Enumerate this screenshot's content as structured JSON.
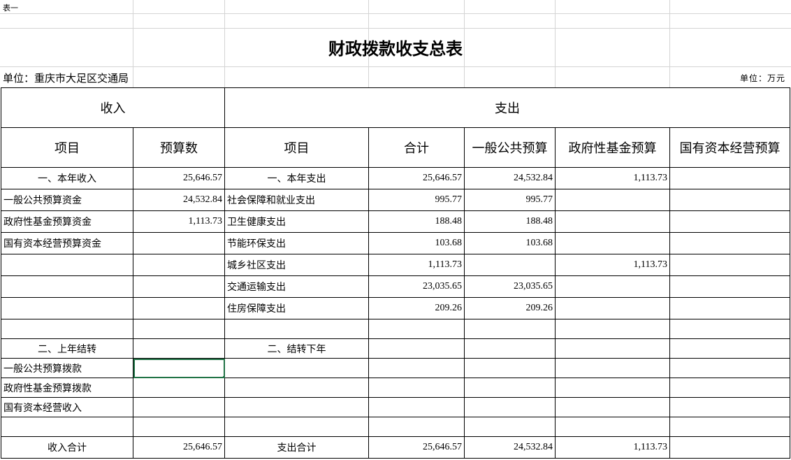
{
  "sheet": {
    "tag": "表一",
    "title": "财政拨款收支总表",
    "unit_left": "单位：重庆市大足区交通局",
    "unit_right": "单位：万元"
  },
  "header": {
    "income": "收入",
    "expense": "支出",
    "col_item_in": "项目",
    "col_budget": "预算数",
    "col_item_out": "项目",
    "col_total": "合计",
    "col_general": "一般公共预算",
    "col_fund": "政府性基金预算",
    "col_state": "国有资本经营预算"
  },
  "rows": [
    [
      "一、本年收入",
      "25,646.57",
      "一、本年支出",
      "25,646.57",
      "24,532.84",
      "1,113.73",
      ""
    ],
    [
      "一般公共预算资金",
      "24,532.84",
      "社会保障和就业支出",
      "995.77",
      "995.77",
      "",
      ""
    ],
    [
      "政府性基金预算资金",
      "1,113.73",
      "卫生健康支出",
      "188.48",
      "188.48",
      "",
      ""
    ],
    [
      "国有资本经营预算资金",
      "",
      "节能环保支出",
      "103.68",
      "103.68",
      "",
      ""
    ],
    [
      "",
      "",
      "城乡社区支出",
      "1,113.73",
      "",
      "1,113.73",
      ""
    ],
    [
      "",
      "",
      "交通运输支出",
      "23,035.65",
      "23,035.65",
      "",
      ""
    ],
    [
      "",
      "",
      "住房保障支出",
      "209.26",
      "209.26",
      "",
      ""
    ],
    [
      "",
      "",
      "",
      "",
      "",
      "",
      ""
    ],
    [
      "二、上年结转",
      "",
      "二、结转下年",
      "",
      "",
      "",
      ""
    ],
    [
      "一般公共预算拨款",
      "",
      "",
      "",
      "",
      "",
      ""
    ],
    [
      "政府性基金预算拨款",
      "",
      "",
      "",
      "",
      "",
      ""
    ],
    [
      "国有资本经营收入",
      "",
      "",
      "",
      "",
      "",
      ""
    ],
    [
      "",
      "",
      "",
      "",
      "",
      "",
      ""
    ],
    [
      "收入合计",
      "25,646.57",
      "支出合计",
      "25,646.57",
      "24,532.84",
      "1,113.73",
      ""
    ]
  ]
}
